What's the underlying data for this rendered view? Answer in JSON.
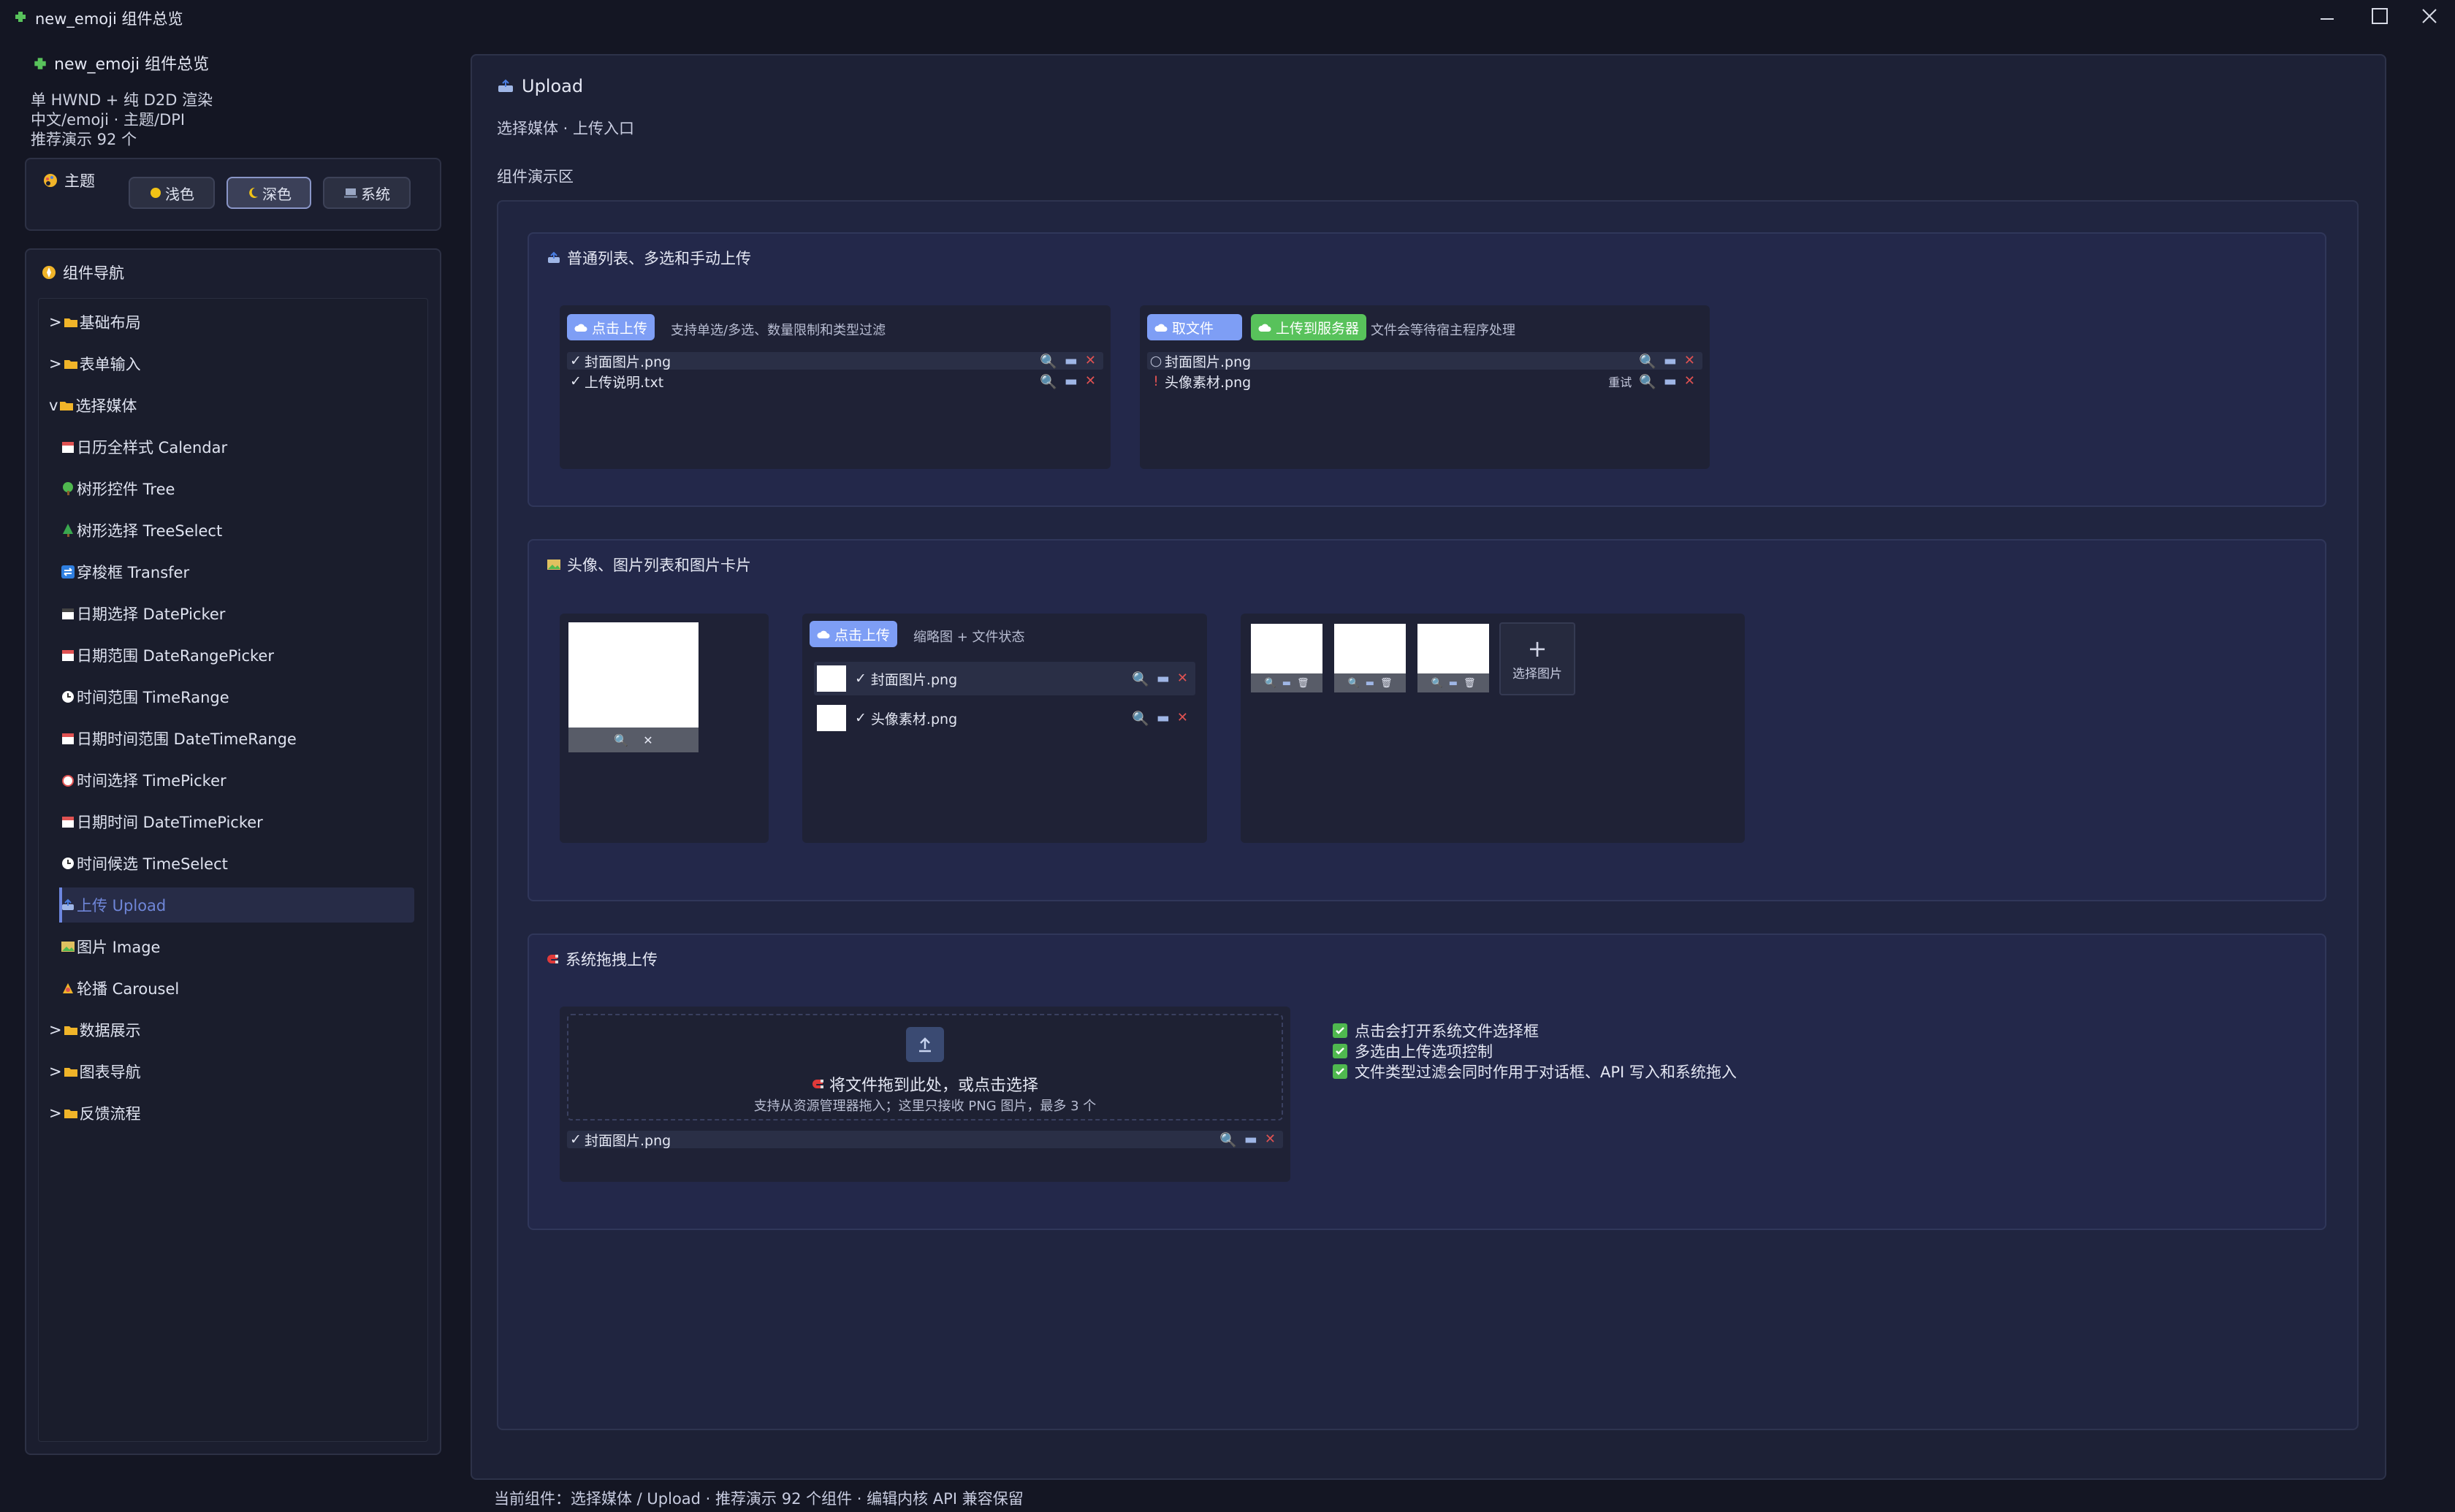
{
  "window": {
    "title": "new_emoji 组件总览"
  },
  "sidebar": {
    "app_title": "new_emoji 组件总览",
    "info": [
      "单 HWND + 纯 D2D 渲染",
      "中文/emoji · 主题/DPI",
      "推荐演示 92 个"
    ],
    "theme": {
      "label": "主题",
      "buttons": [
        "浅色",
        "深色",
        "系统"
      ],
      "selected": "深色"
    },
    "nav": {
      "title": "组件导航",
      "items": [
        {
          "label": "基础布局",
          "prefix": ">"
        },
        {
          "label": "表单输入",
          "prefix": ">"
        },
        {
          "label": "选择媒体",
          "prefix": "v"
        },
        {
          "label": "日历全样式 Calendar"
        },
        {
          "label": "树形控件 Tree"
        },
        {
          "label": "树形选择 TreeSelect"
        },
        {
          "label": "穿梭框 Transfer"
        },
        {
          "label": "日期选择 DatePicker"
        },
        {
          "label": "日期范围 DateRangePicker"
        },
        {
          "label": "时间范围 TimeRange"
        },
        {
          "label": "日期时间范围 DateTimeRange"
        },
        {
          "label": "时间选择 TimePicker"
        },
        {
          "label": "日期时间 DateTimePicker"
        },
        {
          "label": "时间候选 TimeSelect"
        },
        {
          "label": "上传 Upload"
        },
        {
          "label": "图片 Image"
        },
        {
          "label": "轮播 Carousel"
        },
        {
          "label": "数据展示",
          "prefix": ">"
        },
        {
          "label": "图表导航",
          "prefix": ">"
        },
        {
          "label": "反馈流程",
          "prefix": ">"
        }
      ],
      "selected": "上传 Upload"
    }
  },
  "main": {
    "title": "Upload",
    "subtitle": "选择媒体 · 上传入口",
    "demo_label": "组件演示区",
    "sections": {
      "list": {
        "title": "普通列表、多选和手动上传",
        "left": {
          "button": "点击上传",
          "hint": "支持单选/多选、数量限制和类型过滤",
          "files": [
            {
              "mark": "✓",
              "name": "封面图片.png"
            },
            {
              "mark": "✓",
              "name": "上传说明.txt"
            }
          ]
        },
        "right": {
          "pick_button": "取文件",
          "upload_button": "上传到服务器",
          "hint": "文件会等待宿主程序处理",
          "files": [
            {
              "mark": "○",
              "name": "封面图片.png"
            },
            {
              "mark": "!",
              "name": "头像素材.png",
              "retry": "重试"
            }
          ]
        }
      },
      "image": {
        "title": "头像、图片列表和图片卡片",
        "list_button": "点击上传",
        "list_hint": "缩略图 + 文件状态",
        "files": [
          {
            "mark": "✓",
            "name": "封面图片.png"
          },
          {
            "mark": "✓",
            "name": "头像素材.png"
          }
        ],
        "card_add": "选择图片"
      },
      "drag": {
        "title": "系统拖拽上传",
        "drop_main": "将文件拖到此处，或点击选择",
        "drop_sub": "支持从资源管理器拖入；这里只接收 PNG 图片，最多 3 个",
        "file": {
          "mark": "✓",
          "name": "封面图片.png"
        },
        "checks": [
          "点击会打开系统文件选择框",
          "多选由上传选项控制",
          "文件类型过滤会同时作用于对话框、API 写入和系统拖入"
        ]
      }
    }
  },
  "status": "当前组件：选择媒体 / Upload · 推荐演示 92 个组件 · 编辑内核 API 兼容保留",
  "colors": {
    "accent": "#7e9ef5",
    "success": "#58c25b",
    "danger": "#e05252",
    "background": "#141623"
  }
}
